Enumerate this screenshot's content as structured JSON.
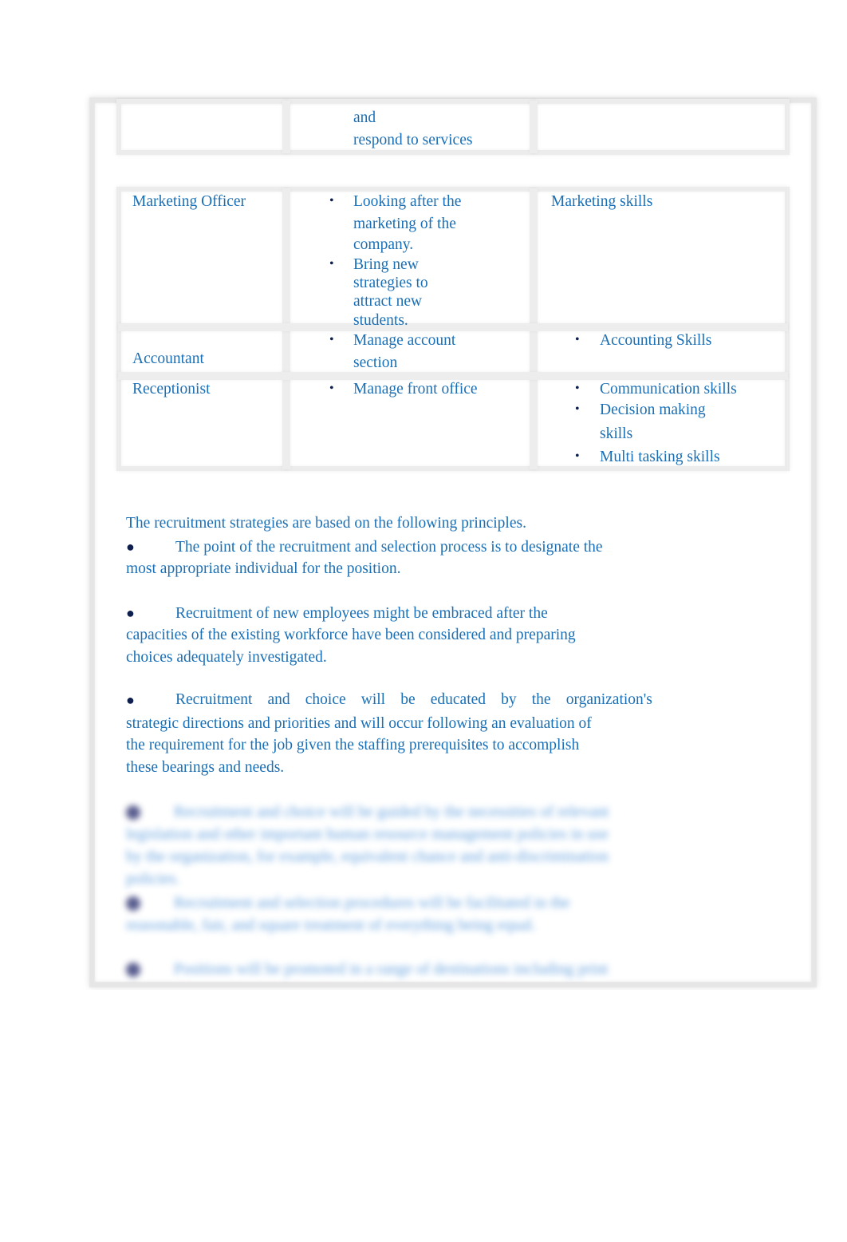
{
  "table_top_row": {
    "duties_lines": [
      "and",
      "respond to services"
    ]
  },
  "table_rows": [
    {
      "role": "Marketing Officer",
      "duties": [
        {
          "lines": [
            "Looking after the",
            "marketing of the",
            "company."
          ]
        },
        {
          "lines": [
            "Bring new",
            "strategies to",
            "attract new",
            "students."
          ]
        }
      ],
      "skills_plain": "Marketing skills"
    },
    {
      "role": "Accountant",
      "duties": [
        {
          "lines": [
            "Manage account",
            "section"
          ]
        }
      ],
      "skills": [
        {
          "lines": [
            "Accounting Skills"
          ]
        }
      ]
    },
    {
      "role": "Receptionist",
      "duties": [
        {
          "lines": [
            "Manage front office"
          ]
        }
      ],
      "skills": [
        {
          "lines": [
            "Communication skills"
          ]
        },
        {
          "lines": [
            "Decision making",
            "skills"
          ]
        },
        {
          "lines": [
            "Multi tasking skills"
          ]
        }
      ]
    }
  ],
  "bullet_glyph": "•",
  "principles": {
    "intro": "The recruitment strategies are based on the following principles.",
    "bullet_glyph": "●",
    "items": [
      {
        "first_line": "The point of the recruitment and selection process is to designate the",
        "rest": [
          "most appropriate individual for the position."
        ]
      },
      {
        "first_line": "Recruitment of new employees might be embraced after the",
        "rest": [
          "capacities of the existing workforce have been considered and preparing",
          "choices adequately investigated."
        ]
      },
      {
        "first_line_words": [
          "Recruitment",
          "and",
          "choice",
          "will",
          "be",
          "educated",
          "by",
          "the",
          "organization's"
        ],
        "rest": [
          "strategic directions and priorities and will occur following an evaluation of",
          "the requirement for the job given the staffing prerequisites to accomplish",
          "these bearings and needs."
        ]
      }
    ]
  },
  "blurred_preview": {
    "items": [
      {
        "lines": [
          "Recruitment and choice will be guided by the necessities of relevant",
          "legislation and other important human resource management policies in use",
          "by the organization, for example, equivalent chance and anti-discrimination",
          "policies."
        ]
      },
      {
        "lines": [
          "Recruitment and selection procedures will be facilitated in the",
          "reasonable, fair, and square treatment of everything being equal."
        ]
      },
      {
        "lines": [
          "Positions will be promoted in a range of destinations including print"
        ]
      }
    ]
  }
}
